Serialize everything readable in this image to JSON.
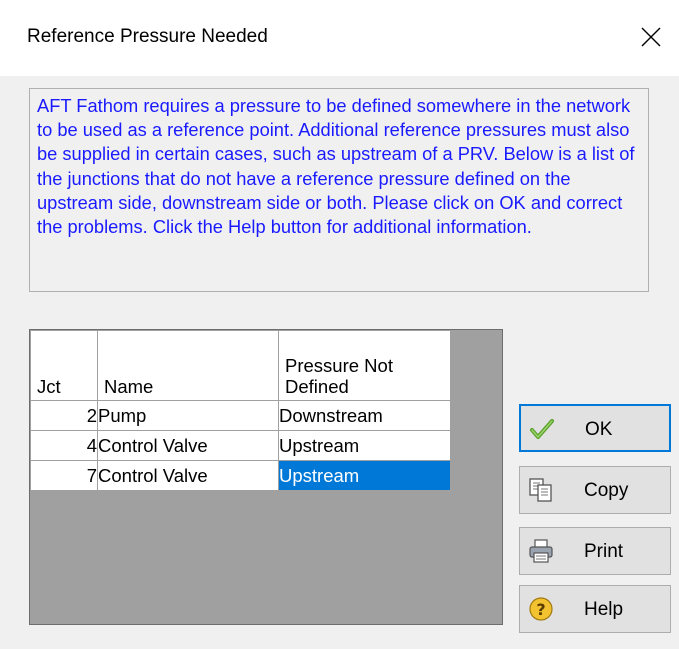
{
  "dialog": {
    "title": "Reference Pressure Needed",
    "message": "AFT Fathom requires a pressure to be defined somewhere in the network to be used as a reference point.  Additional reference pressures must also be supplied in certain cases, such as upstream of a PRV.  Below is a list of the junctions that do not have a reference pressure defined on the upstream side, downstream side or both.  Please click on OK and correct the problems.  Click the Help button for additional information."
  },
  "table": {
    "headers": {
      "jct": "Jct",
      "name": "Name",
      "pressure_line1": "Pressure Not",
      "pressure_line2": "Defined"
    },
    "rows": [
      {
        "jct": "2",
        "name": "Pump",
        "pressure": "Downstream"
      },
      {
        "jct": "4",
        "name": "Control Valve",
        "pressure": "Upstream"
      },
      {
        "jct": "7",
        "name": "Control Valve",
        "pressure": "Upstream"
      }
    ],
    "selection_color": "#0078d7"
  },
  "buttons": {
    "ok": {
      "label": "OK",
      "icon": "checkmark-icon"
    },
    "copy": {
      "label": "Copy",
      "icon": "copy-icon"
    },
    "print": {
      "label": "Print",
      "icon": "printer-icon"
    },
    "help": {
      "label": "Help",
      "icon": "help-icon"
    }
  },
  "colors": {
    "message_text": "#1a1aff",
    "accent": "#0078d7"
  }
}
